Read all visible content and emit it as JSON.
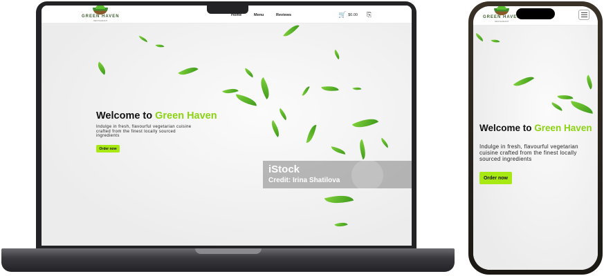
{
  "brand": {
    "logo_text": "GREEN HAVEN",
    "logo_subtext": "RESTAURANT",
    "accent_color": "#a8e813"
  },
  "nav": {
    "links": [
      {
        "label": "Home"
      },
      {
        "label": "Menu"
      },
      {
        "label": "Reviews"
      }
    ],
    "cart_total": "$0.00",
    "cart_icon": "cart-icon",
    "login_icon": "login-icon"
  },
  "hero": {
    "title_prefix": "Welcome to ",
    "title_accent": "Green Haven",
    "subtitle": "Indulge in fresh, flavourful vegetarian cuisine crafted from the finest locally sourced ingredients",
    "cta_label": "Order now"
  },
  "watermark": {
    "brand": "iStock",
    "credit": "Credit: Irina Shatilova"
  },
  "mobile": {
    "menu_icon": "hamburger-icon"
  }
}
